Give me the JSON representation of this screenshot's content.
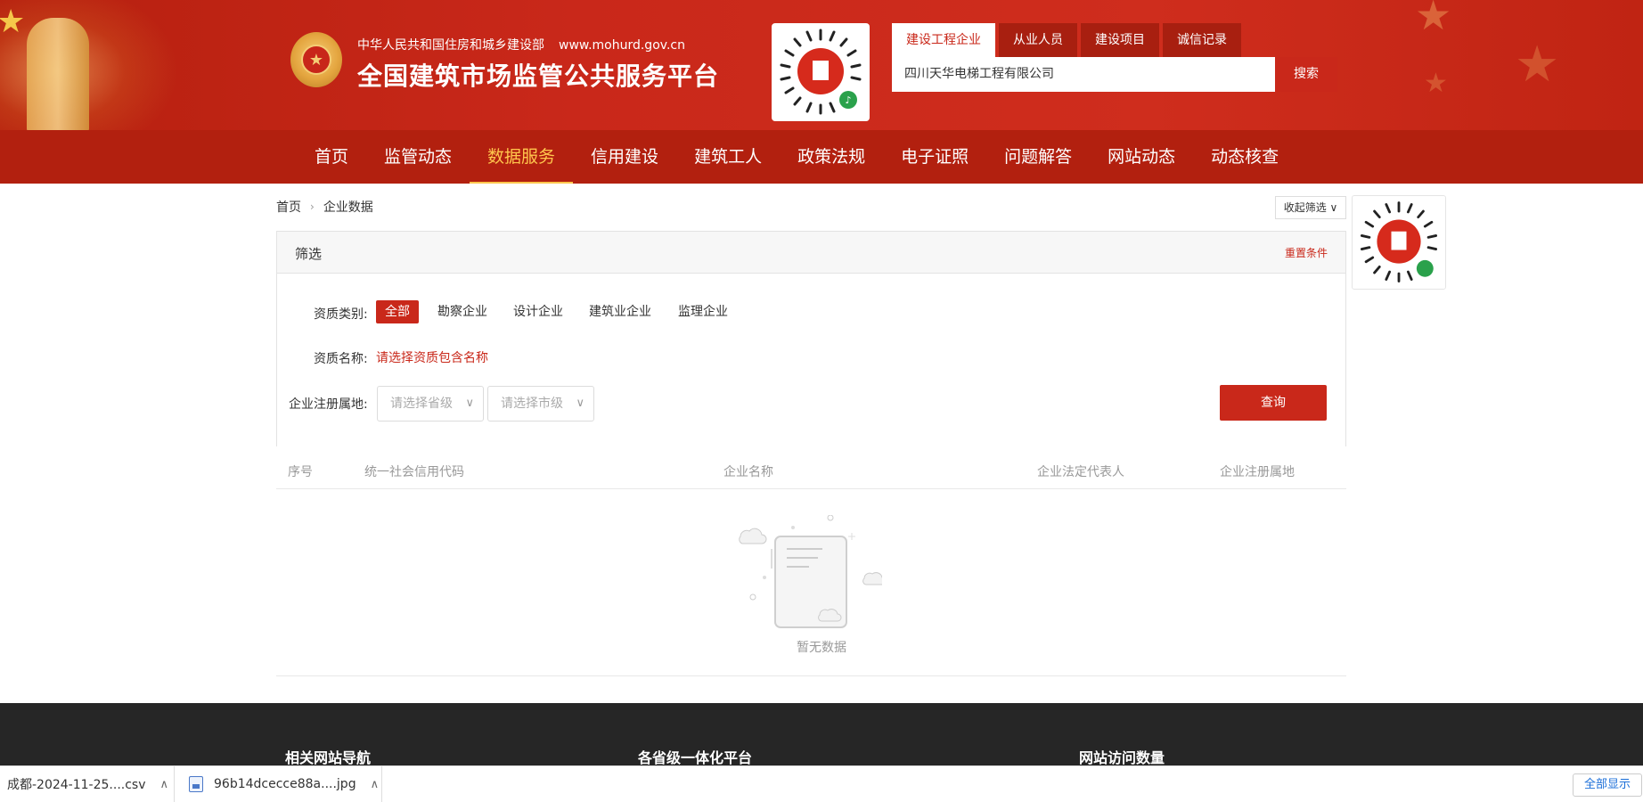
{
  "header": {
    "ministry": "中华人民共和国住房和城乡建设部",
    "url": "www.mohurd.gov.cn",
    "title": "全国建筑市场监管公共服务平台"
  },
  "search": {
    "tabs": [
      "建设工程企业",
      "从业人员",
      "建设项目",
      "诚信记录"
    ],
    "active_tab": 0,
    "value": "四川天华电梯工程有限公司",
    "button": "搜索"
  },
  "nav": {
    "items": [
      "首页",
      "监管动态",
      "数据服务",
      "信用建设",
      "建筑工人",
      "政策法规",
      "电子证照",
      "问题解答",
      "网站动态",
      "动态核查"
    ],
    "active": 2
  },
  "breadcrumb": {
    "home": "首页",
    "current": "企业数据"
  },
  "collapse_filter": "收起筛选",
  "filter": {
    "title": "筛选",
    "reset": "重置条件",
    "qual_type_label": "资质类别:",
    "qual_types": [
      "全部",
      "勘察企业",
      "设计企业",
      "建筑业企业",
      "监理企业"
    ],
    "qual_name_label": "资质名称:",
    "qual_name_placeholder": "请选择资质包含名称",
    "region_label": "企业注册属地:",
    "province_placeholder": "请选择省级",
    "city_placeholder": "请选择市级",
    "query_button": "查询"
  },
  "table": {
    "columns": [
      "序号",
      "统一社会信用代码",
      "企业名称",
      "企业法定代表人",
      "企业注册属地"
    ],
    "empty_text": "暂无数据"
  },
  "footer": {
    "cols": [
      "相关网站导航",
      "各省级一体化平台",
      "网站访问数量"
    ]
  },
  "downloads": {
    "items": [
      "成都-2024-11-25....csv",
      "96b14dcecce88a....jpg"
    ],
    "show_all": "全部显示"
  },
  "colors": {
    "brand_red": "#c9281a",
    "nav_active": "#ffc64d",
    "footer_bg": "#262626"
  }
}
